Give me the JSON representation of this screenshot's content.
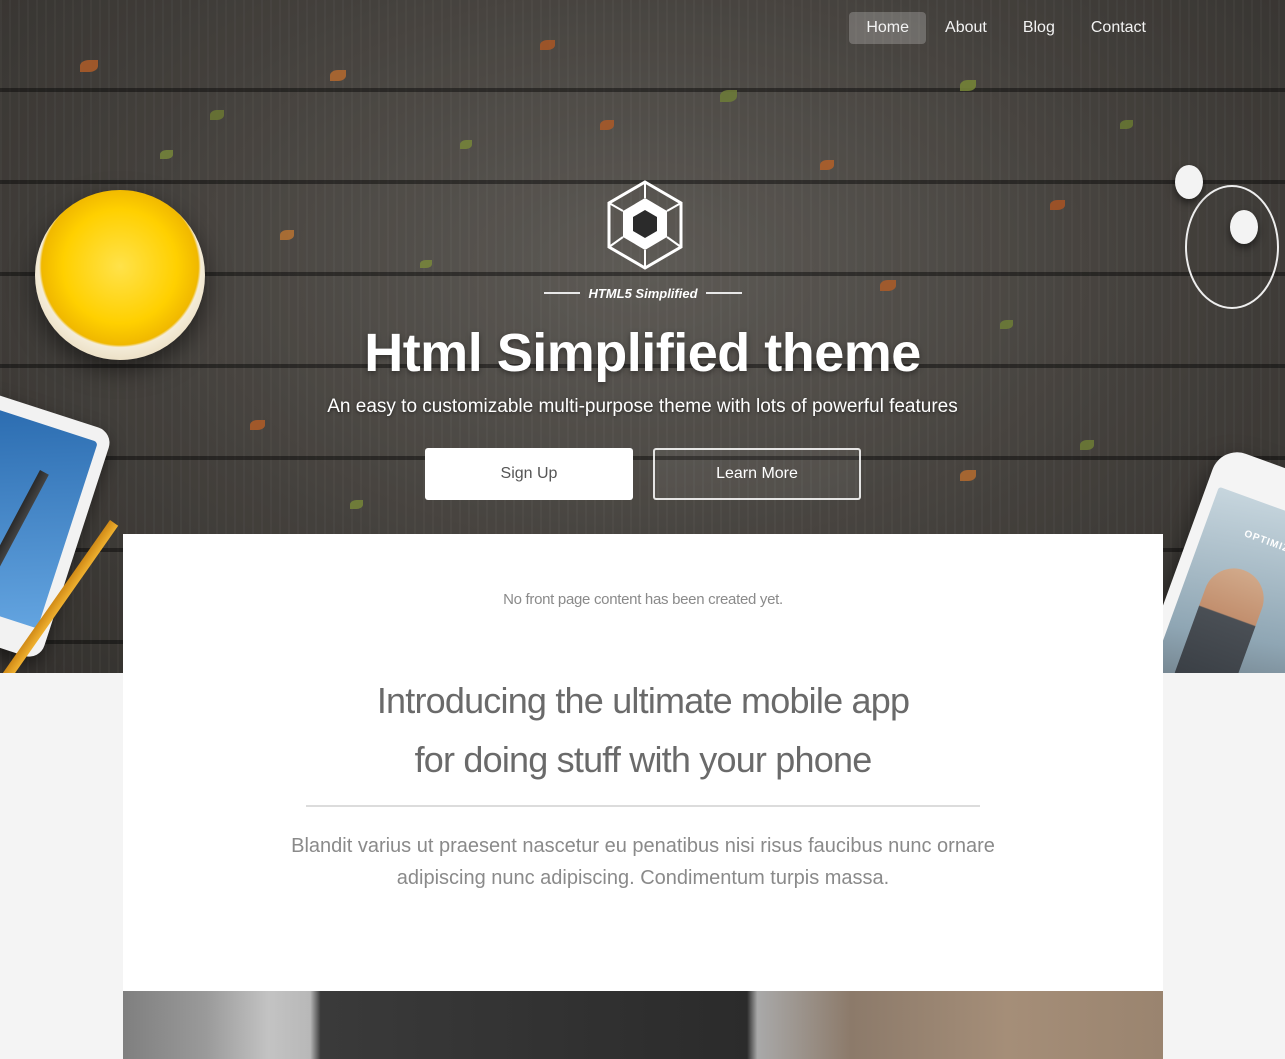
{
  "nav": {
    "items": [
      {
        "label": "Home",
        "active": true
      },
      {
        "label": "About",
        "active": false
      },
      {
        "label": "Blog",
        "active": false
      },
      {
        "label": "Contact",
        "active": false
      }
    ]
  },
  "hero": {
    "brand": "HTML5 Simplified",
    "title": "Html Simplified theme",
    "subtitle": "An easy to customizable multi-purpose theme with lots of powerful features",
    "primary_button": "Sign Up",
    "secondary_button": "Learn More"
  },
  "content": {
    "notice": "No front page content has been created yet.",
    "intro_line1": "Introducing the ultimate mobile app",
    "intro_line2": "for doing stuff with your phone",
    "lead": "Blandit varius ut praesent nascetur eu penatibus nisi risus faucibus nunc ornare adipiscing nunc adipiscing. Condimentum turpis massa."
  },
  "colors": {
    "hero_text": "#ffffff",
    "body_text": "#8a8a8a",
    "page_background": "#f4f4f4",
    "panel_background": "#ffffff"
  },
  "icons": {
    "logo": "hexagon-cube-logo-icon"
  }
}
